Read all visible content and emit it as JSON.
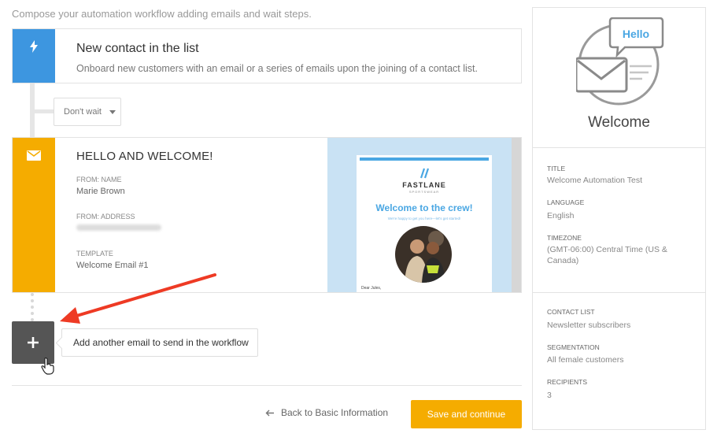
{
  "intro": "Compose your automation workflow adding emails and wait steps.",
  "trigger": {
    "title": "New contact in the list",
    "description": "Onboard new customers with an email or a series of emails upon the joining of a contact list.",
    "icon": "lightning-icon",
    "color": "#3d96e0"
  },
  "wait": {
    "selected": "Don't wait"
  },
  "email_step": {
    "title": "HELLO AND WELCOME!",
    "from_name_label": "FROM: NAME",
    "from_name": "Marie Brown",
    "from_address_label": "FROM: ADDRESS",
    "template_label": "TEMPLATE",
    "template": "Welcome Email #1",
    "icon": "envelope-icon",
    "color": "#f5ac00",
    "preview": {
      "brand": "FASTLANE",
      "brand_sub": "SPORTSWEAR",
      "headline": "Welcome to the crew!",
      "subline": "We're happy to get you here—let's get started!",
      "greeting": "Dear Jules,"
    }
  },
  "add": {
    "icon": "plus-icon",
    "tooltip": "Add another email to send in the workflow"
  },
  "footer": {
    "back_label": "Back to Basic Information",
    "save_label": "Save and continue"
  },
  "side": {
    "bubble_text": "Hello",
    "title": "Welcome",
    "fields": {
      "title_label": "TITLE",
      "title_value": "Welcome Automation Test",
      "language_label": "LANGUAGE",
      "language_value": "English",
      "timezone_label": "TIMEZONE",
      "timezone_value": "(GMT-06:00) Central Time (US & Canada)",
      "contact_list_label": "CONTACT LIST",
      "contact_list_value": "Newsletter subscribers",
      "segmentation_label": "SEGMENTATION",
      "segmentation_value": "All female customers",
      "recipients_label": "RECIPIENTS",
      "recipients_value": "3"
    }
  }
}
